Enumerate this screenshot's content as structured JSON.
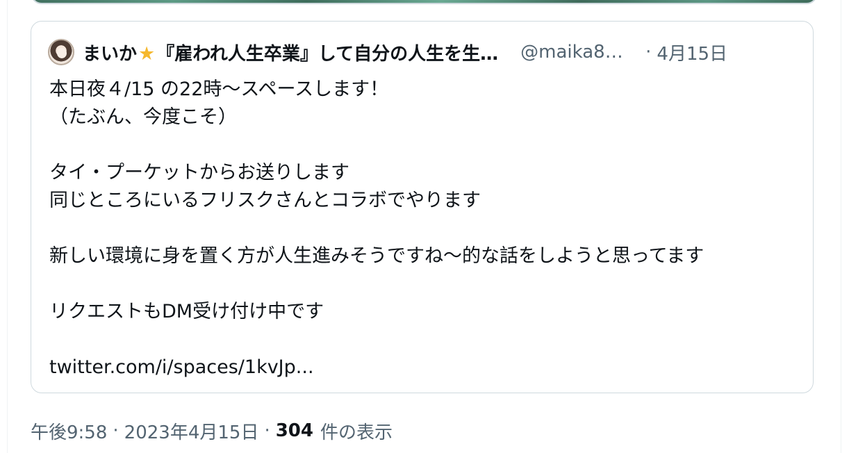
{
  "quoted_tweet": {
    "display_name": "まいか",
    "display_name_rest": "『雇われ人生卒業』して自分の人生を生…",
    "handle": "@maika8…",
    "separator": "·",
    "date": "4月15日",
    "lines": [
      "本日夜４/15 の22時〜スペースします！",
      "（たぶん、今度こそ）",
      "タイ・プーケットからお送りします",
      "同じところにいるフリスクさんとコラボでやります",
      "新しい環境に身を置く方が人生進みそうですね〜的な話をしようと思ってます",
      "リクエストもDM受け付け中です",
      "twitter.com/i/spaces/1kvJp..."
    ]
  },
  "meta": {
    "time": "午後9:58",
    "separator": "·",
    "date": "2023年4月15日",
    "views_count": "304",
    "views_label": "件の表示"
  },
  "colors": {
    "text_primary": "#0f1419",
    "text_secondary": "#536471",
    "border": "#cfd9de",
    "star": "#f5b82e"
  },
  "icons": [
    "avatar",
    "star-icon"
  ]
}
